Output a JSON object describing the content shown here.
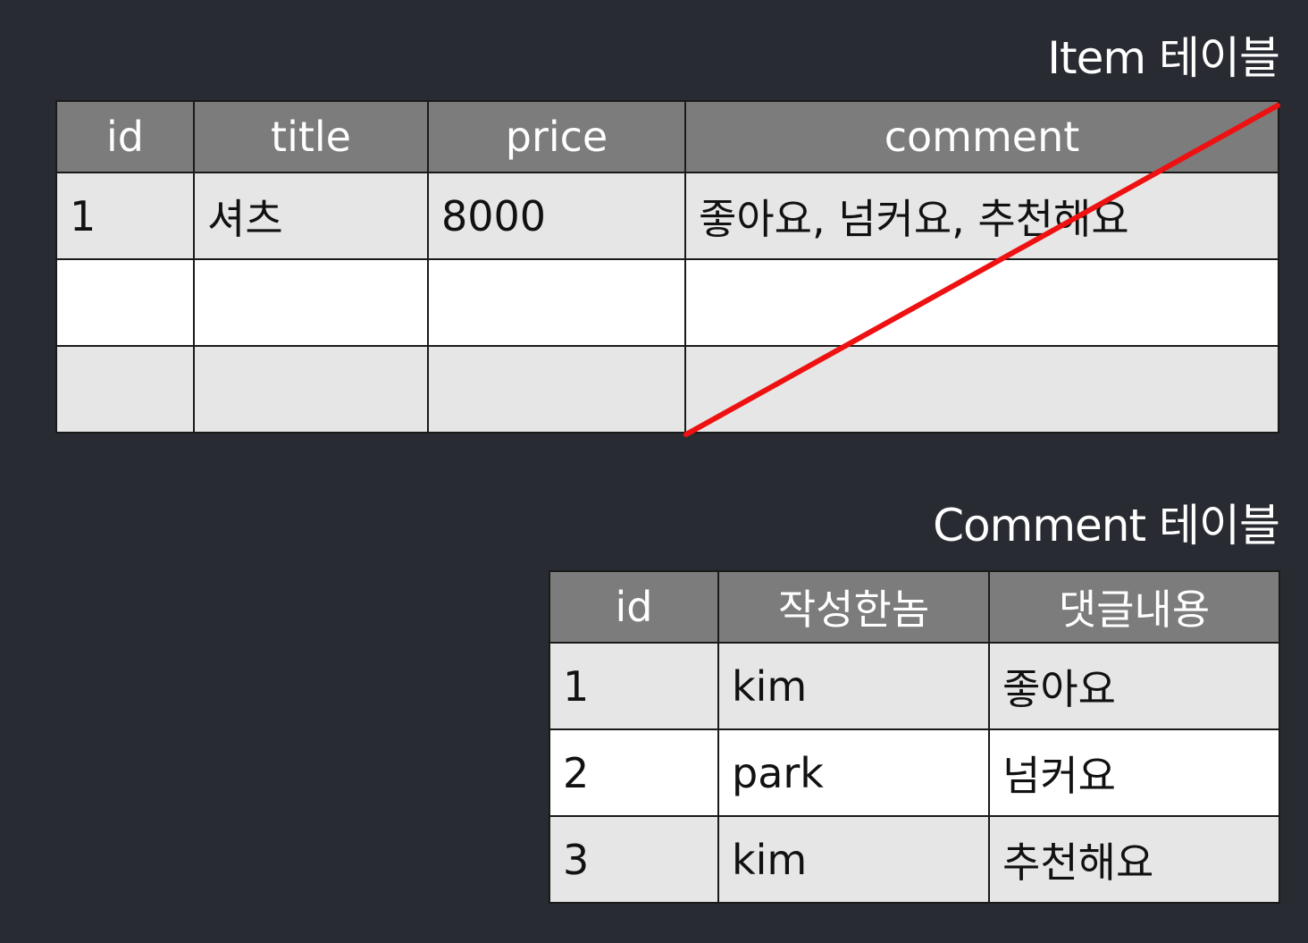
{
  "item_table": {
    "caption": "Item 테이블",
    "columns": [
      "id",
      "title",
      "price",
      "comment"
    ],
    "rows": [
      [
        "1",
        "셔츠",
        "8000",
        "좋아요, 넘커요, 추천해요"
      ],
      [
        "",
        "",
        "",
        ""
      ],
      [
        "",
        "",
        "",
        ""
      ]
    ],
    "strike_color": "#ee1111"
  },
  "comment_table": {
    "caption": "Comment 테이블",
    "columns": [
      "id",
      "작성한놈",
      "댓글내용"
    ],
    "rows": [
      [
        "1",
        "kim",
        "좋아요"
      ],
      [
        "2",
        "park",
        "넘커요"
      ],
      [
        "3",
        "kim",
        "추천해요"
      ]
    ]
  },
  "colors": {
    "background": "#292b33",
    "header": "#7c7c7c",
    "row_shaded": "#e6e6e6",
    "row_white": "#ffffff"
  }
}
